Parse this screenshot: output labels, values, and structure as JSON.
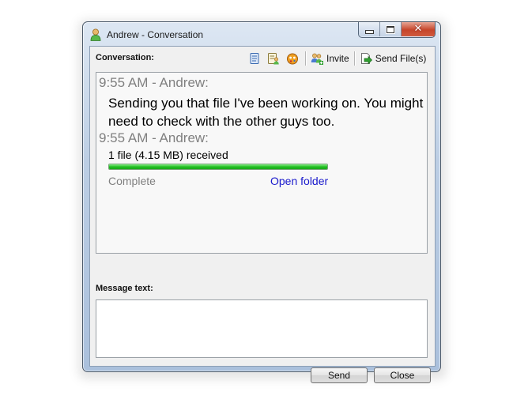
{
  "window": {
    "title": "Andrew - Conversation",
    "close_glyph": "✕"
  },
  "toolbar": {
    "conversation_label": "Conversation:",
    "icons": [
      "history-icon",
      "contact-details-icon",
      "emoticons-icon"
    ],
    "invite_label": "Invite",
    "send_files_label": "Send File(s)"
  },
  "history": {
    "messages": [
      {
        "header": "9:55 AM - Andrew:",
        "text": "Sending you that file I've been working on. You might need to check with the other guys too."
      },
      {
        "header": "9:55 AM - Andrew:",
        "file_transfer": {
          "text": "1 file (4.15 MB) received",
          "progress": 1.0,
          "status": "Complete",
          "action": "Open folder"
        }
      }
    ]
  },
  "compose": {
    "label": "Message text:",
    "value": "",
    "placeholder": ""
  },
  "buttons": {
    "send": "Send",
    "close": "Close"
  },
  "colors": {
    "progress_green": "#22c022",
    "link_blue": "#1a1acc",
    "timestamp_gray": "#808080"
  }
}
